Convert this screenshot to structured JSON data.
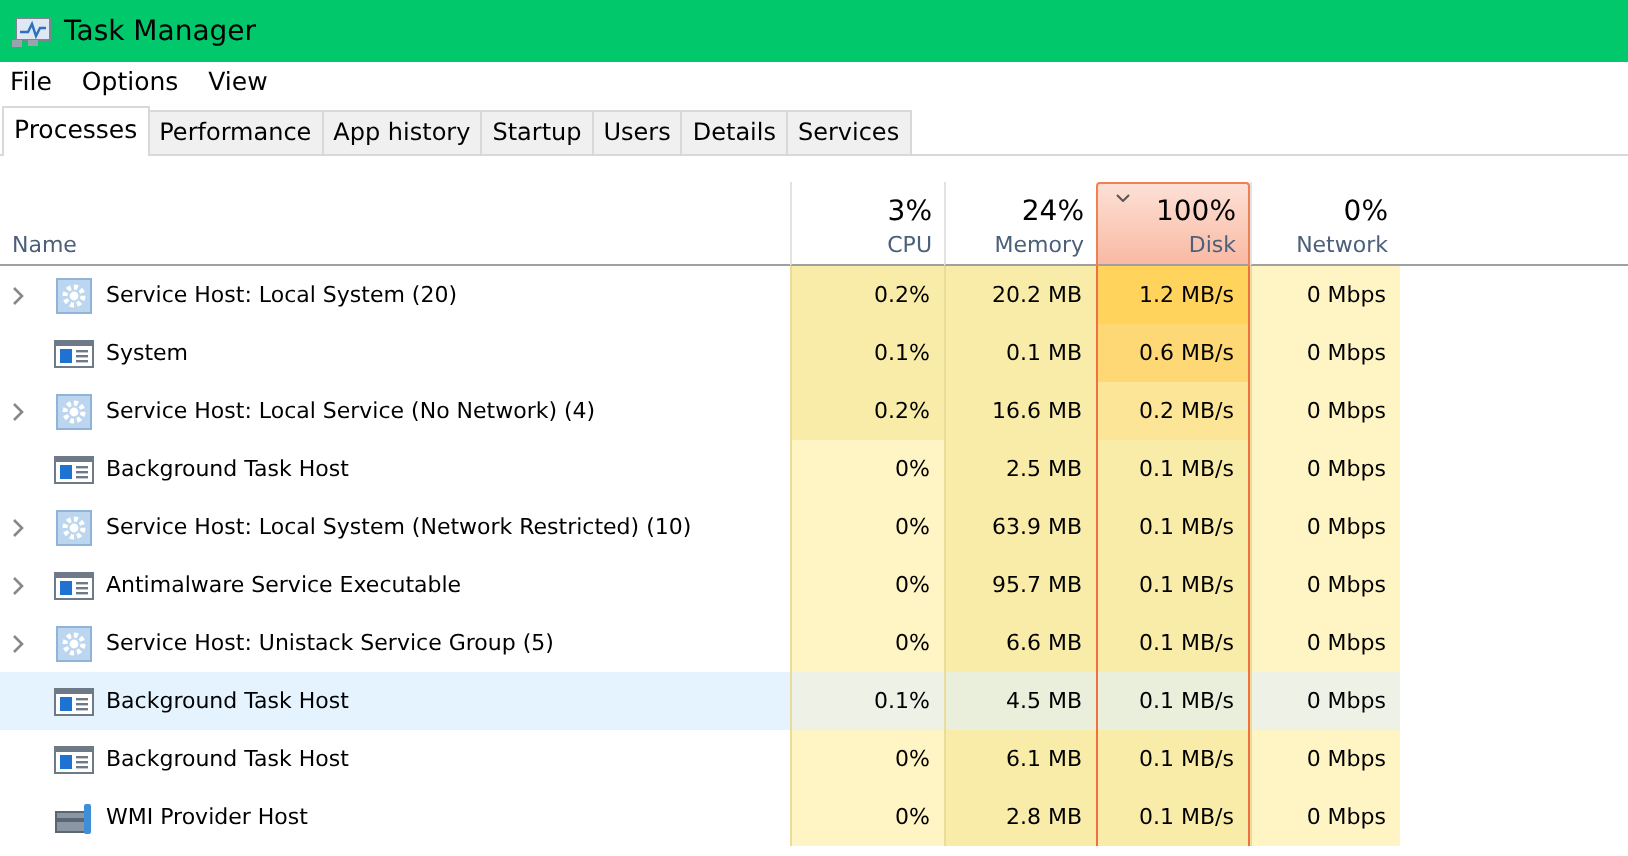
{
  "window": {
    "title": "Task Manager"
  },
  "menu": [
    "File",
    "Options",
    "View"
  ],
  "tabs": [
    {
      "label": "Processes",
      "selected": true
    },
    {
      "label": "Performance",
      "selected": false
    },
    {
      "label": "App history",
      "selected": false
    },
    {
      "label": "Startup",
      "selected": false
    },
    {
      "label": "Users",
      "selected": false
    },
    {
      "label": "Details",
      "selected": false
    },
    {
      "label": "Services",
      "selected": false
    }
  ],
  "table": {
    "name_column": "Name",
    "columns": [
      {
        "percent": "3%",
        "label": "CPU",
        "sorted": false
      },
      {
        "percent": "24%",
        "label": "Memory",
        "sorted": false
      },
      {
        "percent": "100%",
        "label": "Disk",
        "sorted": true
      },
      {
        "percent": "0%",
        "label": "Network",
        "sorted": false
      }
    ],
    "rows": [
      {
        "name": "Service Host: Local System (20)",
        "kind": "service",
        "expandable": true,
        "selected": false,
        "cells": [
          {
            "text": "0.2%",
            "color": "#f9eca8"
          },
          {
            "text": "20.2 MB",
            "color": "#f9eca8"
          },
          {
            "text": "1.2 MB/s",
            "color": "#ffd35c"
          },
          {
            "text": "0 Mbps",
            "color": "#fff4c4"
          }
        ]
      },
      {
        "name": "System",
        "kind": "app",
        "expandable": false,
        "selected": false,
        "cells": [
          {
            "text": "0.1%",
            "color": "#f9eca8"
          },
          {
            "text": "0.1 MB",
            "color": "#f9eca8"
          },
          {
            "text": "0.6 MB/s",
            "color": "#fdd874"
          },
          {
            "text": "0 Mbps",
            "color": "#fff4c4"
          }
        ]
      },
      {
        "name": "Service Host: Local Service (No Network) (4)",
        "kind": "service",
        "expandable": true,
        "selected": false,
        "cells": [
          {
            "text": "0.2%",
            "color": "#f9eca8"
          },
          {
            "text": "16.6 MB",
            "color": "#f9eca8"
          },
          {
            "text": "0.2 MB/s",
            "color": "#fce597"
          },
          {
            "text": "0 Mbps",
            "color": "#fff4c4"
          }
        ]
      },
      {
        "name": "Background Task Host",
        "kind": "app",
        "expandable": false,
        "selected": false,
        "cells": [
          {
            "text": "0%",
            "color": "#fff4c4"
          },
          {
            "text": "2.5 MB",
            "color": "#f9eca8"
          },
          {
            "text": "0.1 MB/s",
            "color": "#f9eca8"
          },
          {
            "text": "0 Mbps",
            "color": "#fff4c4"
          }
        ]
      },
      {
        "name": "Service Host: Local System (Network Restricted) (10)",
        "kind": "service",
        "expandable": true,
        "selected": false,
        "cells": [
          {
            "text": "0%",
            "color": "#fff4c4"
          },
          {
            "text": "63.9 MB",
            "color": "#f9eca8"
          },
          {
            "text": "0.1 MB/s",
            "color": "#f9eca8"
          },
          {
            "text": "0 Mbps",
            "color": "#fff4c4"
          }
        ]
      },
      {
        "name": "Antimalware Service Executable",
        "kind": "app",
        "expandable": true,
        "selected": false,
        "cells": [
          {
            "text": "0%",
            "color": "#fff4c4"
          },
          {
            "text": "95.7 MB",
            "color": "#f9eca8"
          },
          {
            "text": "0.1 MB/s",
            "color": "#f9eca8"
          },
          {
            "text": "0 Mbps",
            "color": "#fff4c4"
          }
        ]
      },
      {
        "name": "Service Host: Unistack Service Group (5)",
        "kind": "service",
        "expandable": true,
        "selected": false,
        "cells": [
          {
            "text": "0%",
            "color": "#fff4c4"
          },
          {
            "text": "6.6 MB",
            "color": "#f9eca8"
          },
          {
            "text": "0.1 MB/s",
            "color": "#f9eca8"
          },
          {
            "text": "0 Mbps",
            "color": "#fff4c4"
          }
        ]
      },
      {
        "name": "Background Task Host",
        "kind": "app",
        "expandable": false,
        "selected": true,
        "cells": [
          {
            "text": "0.1%",
            "color": "#eef1e6"
          },
          {
            "text": "4.5 MB",
            "color": "#eaefdc"
          },
          {
            "text": "0.1 MB/s",
            "color": "#eaefdc"
          },
          {
            "text": "0 Mbps",
            "color": "#eef1e6"
          }
        ]
      },
      {
        "name": "Background Task Host",
        "kind": "app",
        "expandable": false,
        "selected": false,
        "cells": [
          {
            "text": "0%",
            "color": "#fff4c4"
          },
          {
            "text": "6.1 MB",
            "color": "#f9eca8"
          },
          {
            "text": "0.1 MB/s",
            "color": "#f9eca8"
          },
          {
            "text": "0 Mbps",
            "color": "#fff4c4"
          }
        ]
      },
      {
        "name": "WMI Provider Host",
        "kind": "wmi",
        "expandable": false,
        "selected": false,
        "cells": [
          {
            "text": "0%",
            "color": "#fff4c4"
          },
          {
            "text": "2.8 MB",
            "color": "#f9eca8"
          },
          {
            "text": "0.1 MB/s",
            "color": "#f9eca8"
          },
          {
            "text": "0 Mbps",
            "color": "#fff4c4"
          }
        ]
      }
    ]
  }
}
